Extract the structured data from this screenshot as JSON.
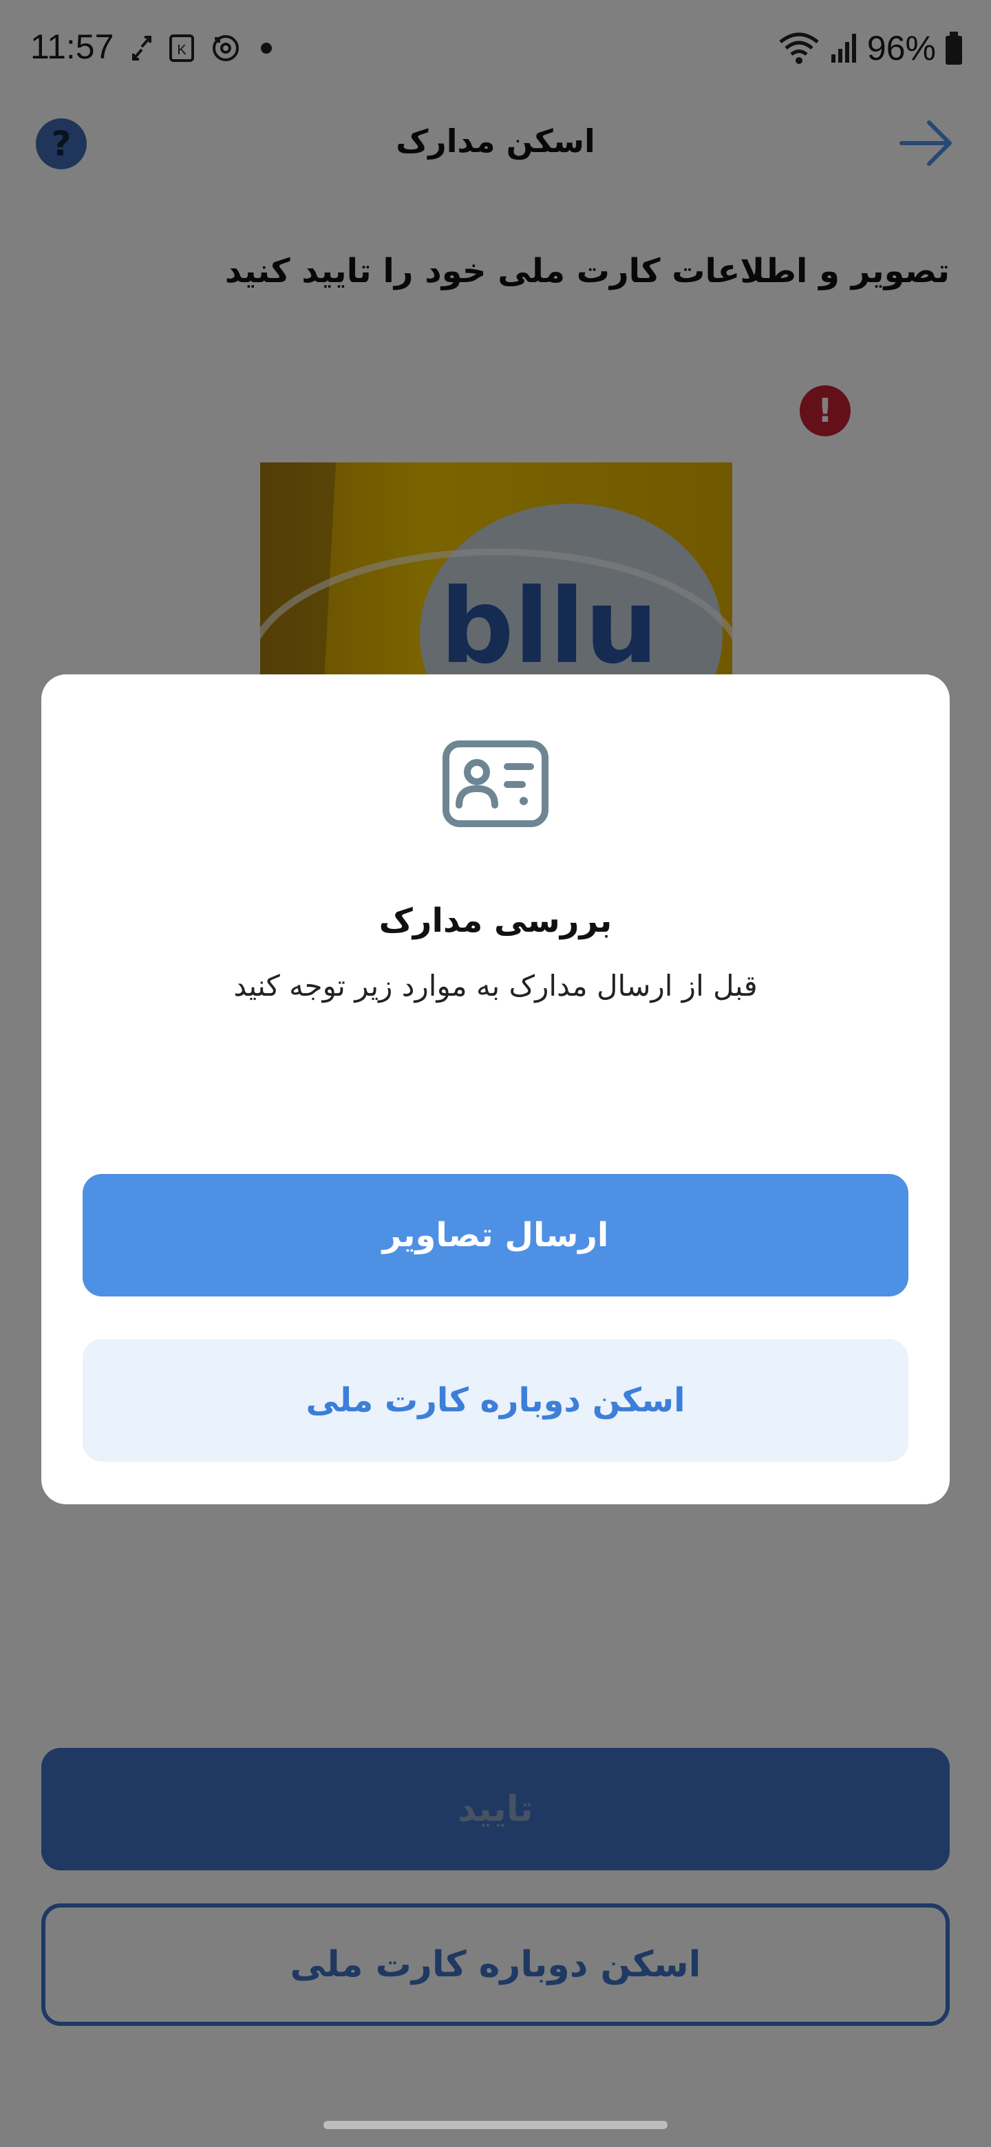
{
  "status_bar": {
    "time": "11:57",
    "battery": "96%",
    "left_icons": [
      "sync-icon",
      "k-app-icon",
      "rotate-icon",
      "dot-icon"
    ],
    "right_icons": [
      "wifi-icon",
      "signal-icon",
      "battery-icon"
    ]
  },
  "header": {
    "title": "اسکن مدارک",
    "help_label": "?"
  },
  "main": {
    "instruction": "تصویر و اطلاعات کارت ملی خود را تایید کنید",
    "error_badge": "!",
    "confirm_label": "تایید",
    "rescan_label": "اسکن دوباره کارت ملی"
  },
  "dialog": {
    "icon": "id-card-icon",
    "title": "بررسی مدارک",
    "subtitle": "قبل از ارسال مدارک به موارد زیر توجه کنید",
    "send_label": "ارسال تصاویر",
    "rescan_label": "اسکن دوباره کارت ملی"
  },
  "colors": {
    "primary": "#4e90e4",
    "primary_light": "#eaf2fc",
    "error": "#c62033",
    "card_yellow": "#f2c200"
  }
}
